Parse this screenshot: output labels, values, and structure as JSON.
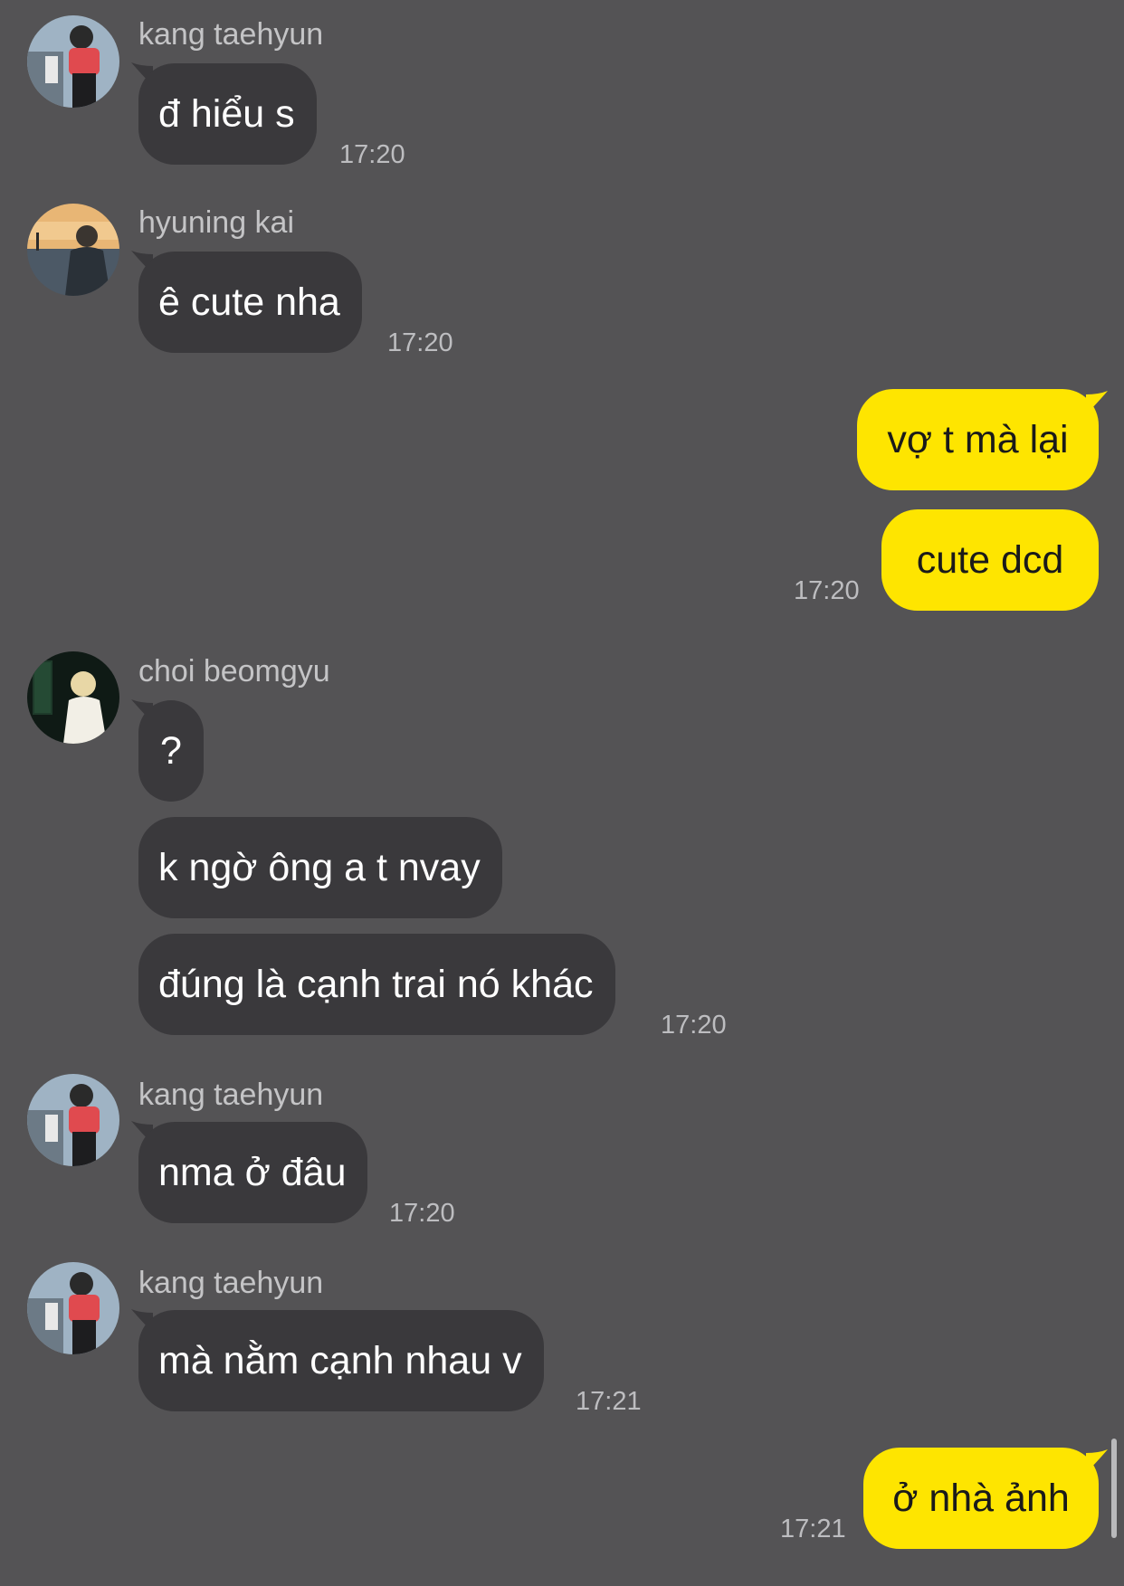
{
  "colors": {
    "background": "#545355",
    "incoming_bubble": "#3a393c",
    "outgoing_bubble": "#fee500",
    "sender_name": "#c4c4c6",
    "timestamp": "#bdbdc0"
  },
  "messages": [
    {
      "sender": "kang taehyun",
      "text": "đ hiểu s",
      "time": "17:20"
    },
    {
      "sender": "hyuning kai",
      "text": "ê cute nha",
      "time": "17:20"
    },
    {
      "text": "vợ t mà lại"
    },
    {
      "text": "cute dcd",
      "time": "17:20"
    },
    {
      "sender": "choi beomgyu",
      "text": "?"
    },
    {
      "text": "k ngờ ông a t nvay"
    },
    {
      "text": "đúng là cạnh trai nó khác",
      "time": "17:20"
    },
    {
      "sender": "kang taehyun",
      "text": "nma ở đâu",
      "time": "17:20"
    },
    {
      "sender": "kang taehyun",
      "text": "mà nằm cạnh nhau v",
      "time": "17:21"
    },
    {
      "text": "ở nhà ảnh",
      "time": "17:21"
    }
  ]
}
